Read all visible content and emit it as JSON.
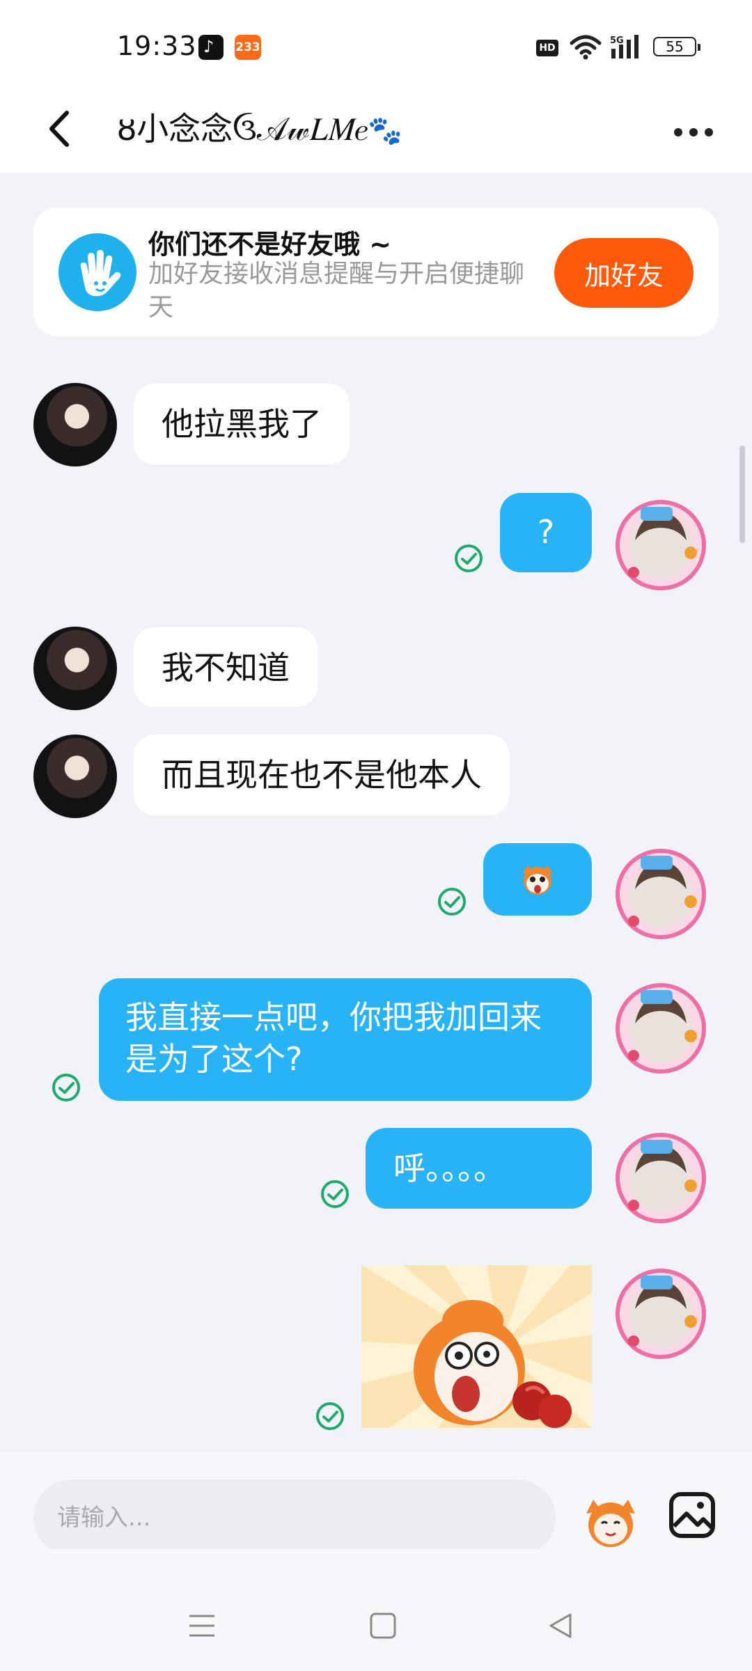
{
  "status_bar": {
    "time": "19:33",
    "app_badge": "233",
    "hd_label": "HD",
    "network": "5G",
    "battery": "55"
  },
  "header": {
    "title": "ȣ小念念ઉ𝒜𝓌𝐿𝑀𝑒",
    "paw": "🐾",
    "back_icon": "chevron-left-icon",
    "more_icon": "more-horizontal-icon"
  },
  "friend_notice": {
    "title": "你们还不是好友哦 ~",
    "description": "加好友接收消息提醒与开启便捷聊天",
    "button": "加好友",
    "icon": "hand-wave-icon"
  },
  "messages": [
    {
      "side": "in",
      "text": "他拉黑我了"
    },
    {
      "side": "out",
      "text": "?"
    },
    {
      "side": "in",
      "text": "我不知道"
    },
    {
      "side": "in",
      "text": "而且现在也不是他本人"
    },
    {
      "side": "out",
      "type": "emoji"
    },
    {
      "side": "out",
      "text": "我直接一点吧，你把我加回来是为了这个?"
    },
    {
      "side": "out",
      "text": "呼。。。。"
    },
    {
      "side": "out",
      "type": "sticker"
    }
  ],
  "composer": {
    "placeholder": "请输入...",
    "emoji_icon": "emoji-sticker-icon",
    "image_icon": "image-icon"
  },
  "colors": {
    "outgoing_bubble": "#27b3f5",
    "accent_button": "#ff5a0c",
    "read_check": "#1faa6d"
  }
}
